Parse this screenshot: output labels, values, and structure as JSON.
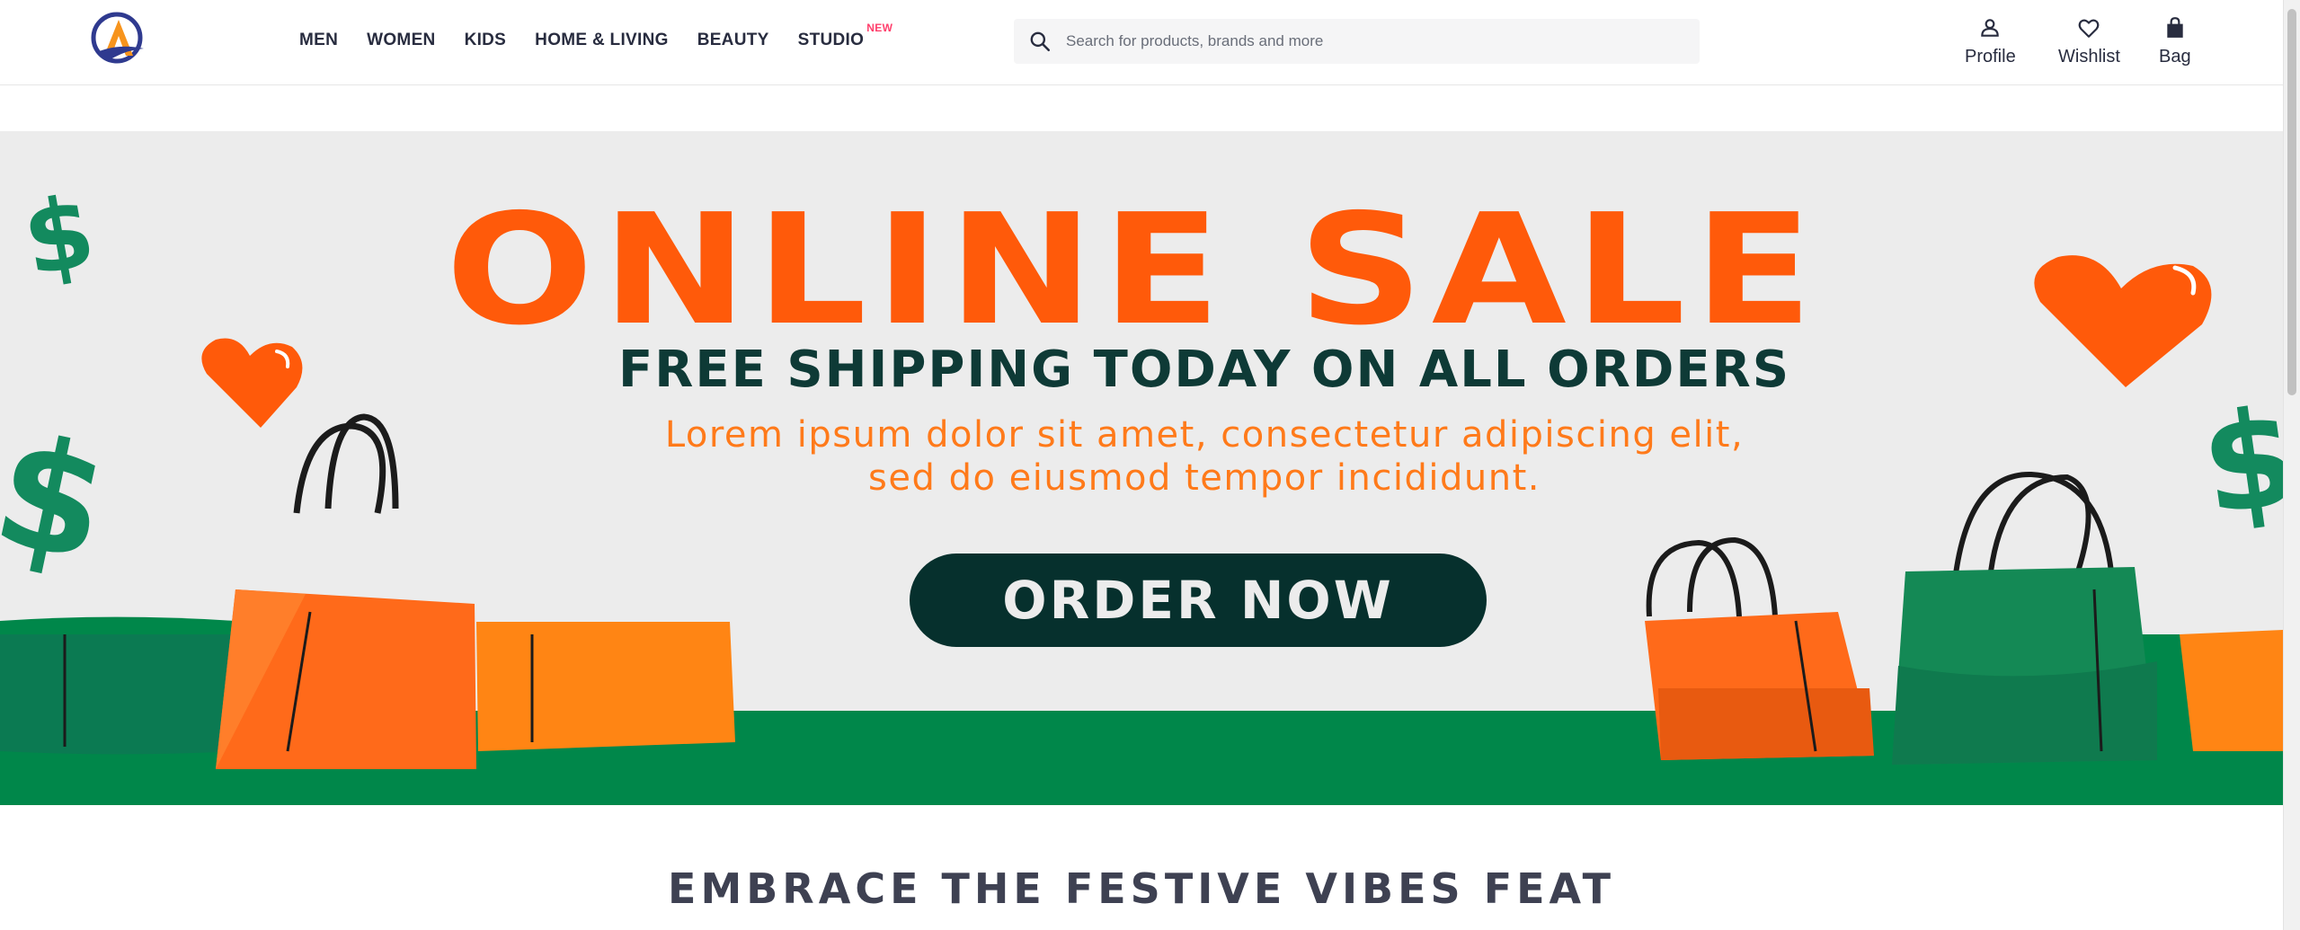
{
  "header": {
    "logo_alt": "A",
    "nav": [
      {
        "label": "MEN"
      },
      {
        "label": "WOMEN"
      },
      {
        "label": "KIDS"
      },
      {
        "label": "HOME & LIVING"
      },
      {
        "label": "BEAUTY"
      },
      {
        "label": "STUDIO",
        "badge": "NEW"
      }
    ],
    "search": {
      "placeholder": "Search for products, brands and more",
      "icon": "search-icon"
    },
    "actions": [
      {
        "label": "Profile",
        "icon": "person-icon"
      },
      {
        "label": "Wishlist",
        "icon": "heart-icon"
      },
      {
        "label": "Bag",
        "icon": "bag-icon"
      }
    ]
  },
  "banner": {
    "title": "ONLINE SALE",
    "subtitle": "FREE SHIPPING TODAY ON ALL ORDERS",
    "lorem_line1": "Lorem ipsum dolor sit amet, consectetur adipiscing elit,",
    "lorem_line2": "sed do eiusmod tempor incididunt.",
    "cta": "ORDER NOW",
    "colors": {
      "title": "#ff5a0a",
      "subtitle": "#0e3a36",
      "lorem": "#ff7a1a",
      "cta_bg": "#06302d",
      "green": "#00874a",
      "orange_bag": "#ff6a1a"
    }
  },
  "section": {
    "heading": "EMBRACE THE FESTIVE VIBES FEAT"
  }
}
